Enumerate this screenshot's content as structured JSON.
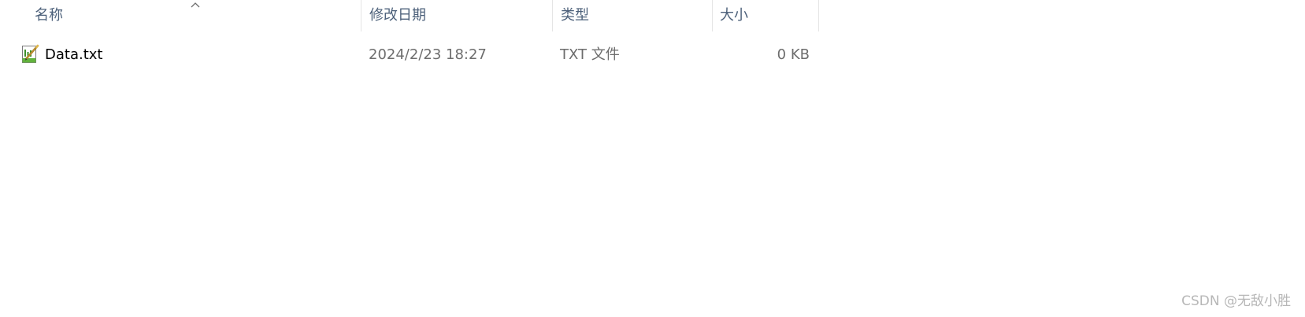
{
  "columns": {
    "name": "名称",
    "modified": "修改日期",
    "type": "类型",
    "size": "大小"
  },
  "sort": {
    "column": "name",
    "icon": "chevron-up-icon"
  },
  "files": [
    {
      "name": "Data.txt",
      "modified": "2024/2/23 18:27",
      "type": "TXT 文件",
      "size": "0 KB",
      "icon": "text-file-icon"
    }
  ],
  "watermark": "CSDN @无敌小胜",
  "colors": {
    "header_text": "#4c607a",
    "detail_text": "#6d6d6d",
    "divider": "#e5e5e5",
    "watermark": "#b7b7b7"
  }
}
